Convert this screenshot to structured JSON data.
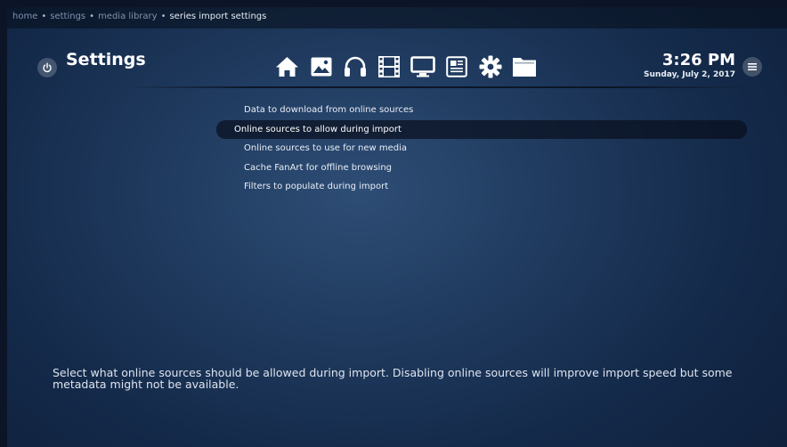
{
  "breadcrumb": {
    "items": [
      "home",
      "settings",
      "media library"
    ],
    "current": "series import settings",
    "separator": "•"
  },
  "header": {
    "title": "Settings",
    "time": "3:26 PM",
    "date": "Sunday, July 2, 2017"
  },
  "nav_icons": [
    "home-icon",
    "pictures-icon",
    "music-icon",
    "videos-icon",
    "tv-icon",
    "news-icon",
    "settings-gear-icon",
    "folder-icon"
  ],
  "settings": {
    "focused_index": 1,
    "items": [
      "Data to download from online sources",
      "Online sources to allow during import",
      "Online sources to use for new media",
      "Cache FanArt for offline browsing",
      "Filters to populate during import"
    ]
  },
  "description": "Select what online sources should be allowed during import. Disabling online sources will improve import speed but some metadata might not be available.",
  "colors": {
    "background": "#1f3a5e",
    "focus_row": "#0e1628",
    "text": "#e9eef6"
  }
}
